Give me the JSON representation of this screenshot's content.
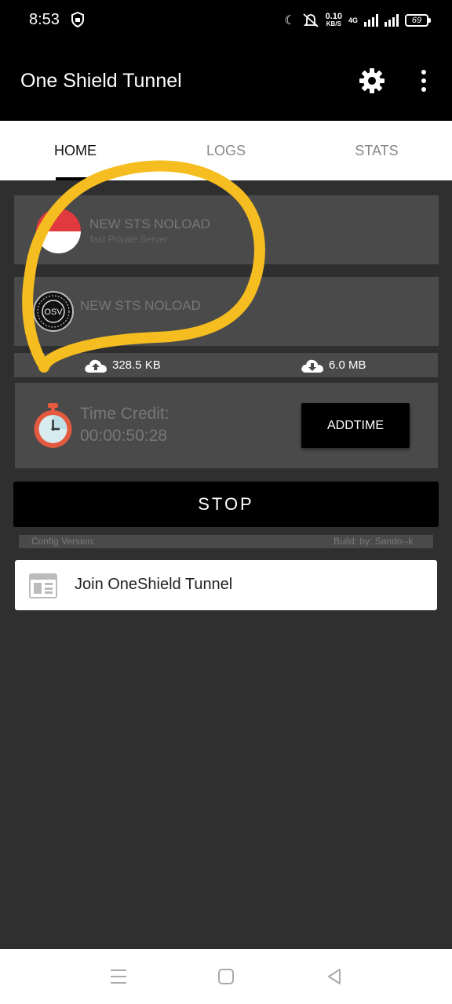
{
  "status_bar": {
    "time": "8:53",
    "speed_value": "0.10",
    "speed_unit": "KB/S",
    "network": "4G",
    "battery": "69"
  },
  "app": {
    "title": "One Shield Tunnel",
    "icons": [
      "gear-icon",
      "more-vert-icon"
    ]
  },
  "tabs": [
    {
      "label": "HOME",
      "active": true
    },
    {
      "label": "LOGS",
      "active": false
    },
    {
      "label": "STATS",
      "active": false
    }
  ],
  "servers": [
    {
      "name": "NEW STS NOLOAD",
      "subtitle": "fast Private Server",
      "icon": "flag-icon"
    },
    {
      "name": "NEW STS NOLOAD",
      "icon": "osv-logo-icon"
    }
  ],
  "traffic": {
    "upload": "328.5 KB",
    "download": "6.0 MB"
  },
  "credit": {
    "label": "Time Credit:",
    "value": "00:00:50:28",
    "button": "ADDTIME"
  },
  "stop_label": "STOP",
  "config": {
    "version_label": "Config Version:",
    "build_label": "Build: by: Sando--k"
  },
  "join": {
    "label": "Join OneShield Tunnel"
  },
  "colors": {
    "background": "#2f2f2f",
    "card": "#4a4a4a",
    "highlight": "#f5bd1f"
  }
}
